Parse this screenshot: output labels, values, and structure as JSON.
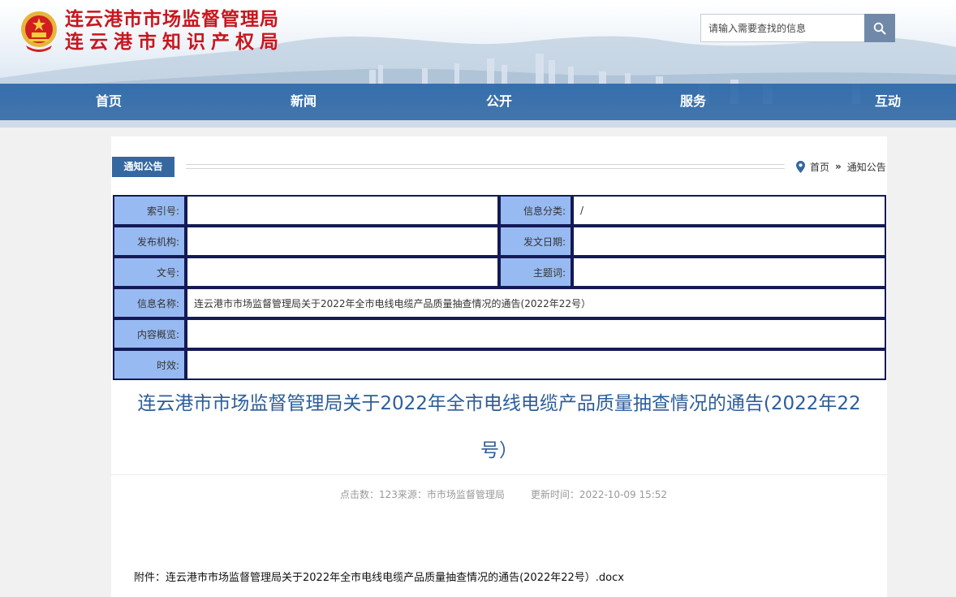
{
  "header": {
    "title_line1": "连云港市市场监督管理局",
    "title_line2": "连云港市知识产权局",
    "search_placeholder": "请输入需要查找的信息",
    "brand_color": "#c8161d"
  },
  "nav": {
    "items": [
      {
        "label": "首页"
      },
      {
        "label": "新闻"
      },
      {
        "label": "公开"
      },
      {
        "label": "服务"
      },
      {
        "label": "互动"
      }
    ]
  },
  "section": {
    "title": "通知公告",
    "breadcrumb": {
      "home": "首页",
      "separator": "»",
      "current": "通知公告"
    }
  },
  "info_table": {
    "index_no": {
      "label": "索引号:",
      "value": ""
    },
    "category": {
      "label": "信息分类:",
      "value": "/"
    },
    "publisher": {
      "label": "发布机构:",
      "value": ""
    },
    "pub_date": {
      "label": "发文日期:",
      "value": ""
    },
    "doc_no": {
      "label": "文号:",
      "value": ""
    },
    "keywords": {
      "label": "主题词:",
      "value": ""
    },
    "info_name": {
      "label": "信息名称:",
      "value": "连云港市市场监督管理局关于2022年全市电线电缆产品质量抽查情况的通告(2022年22号）"
    },
    "summary": {
      "label": "内容概览:",
      "value": ""
    },
    "validity": {
      "label": "时效:",
      "value": ""
    }
  },
  "article": {
    "title": "连云港市市场监督管理局关于2022年全市电线电缆产品质量抽查情况的通告(2022年22号）",
    "meta_clicks": "点击数：123",
    "meta_source": "来源：市市场监督管理局",
    "meta_updated": "更新时间：2022-10-09 15:52",
    "attachment": "附件：连云港市市场监督管理局关于2022年全市电线电缆产品质量抽查情况的通告(2022年22号）.docx"
  },
  "colors": {
    "nav_bg": "#2a67aa",
    "section_tag": "#3568a0",
    "label_cell": "#98baf2",
    "table_border": "#141a55",
    "article_title": "#2c5d9a"
  },
  "icons": [
    "national-emblem-icon",
    "search-icon",
    "location-pin-icon"
  ]
}
